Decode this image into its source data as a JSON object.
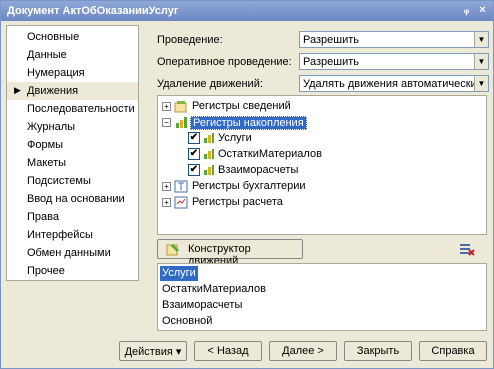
{
  "window": {
    "title": "Документ АктОбОказанииУслуг",
    "pin_glyph": "ᵩ",
    "close_glyph": "×"
  },
  "sidebar": {
    "items": [
      {
        "label": "Основные"
      },
      {
        "label": "Данные"
      },
      {
        "label": "Нумерация"
      },
      {
        "label": "Движения",
        "active": true
      },
      {
        "label": "Последовательности"
      },
      {
        "label": "Журналы"
      },
      {
        "label": "Формы"
      },
      {
        "label": "Макеты"
      },
      {
        "label": "Подсистемы"
      },
      {
        "label": "Ввод на основании"
      },
      {
        "label": "Права"
      },
      {
        "label": "Интерфейсы"
      },
      {
        "label": "Обмен данными"
      },
      {
        "label": "Прочее"
      }
    ],
    "active_arrow": "▶"
  },
  "form": {
    "posting": {
      "label": "Проведение:",
      "value": "Разрешить"
    },
    "online_posting": {
      "label": "Оперативное проведение:",
      "value": "Разрешить"
    },
    "delete_movements": {
      "label": "Удаление движений:",
      "value": "Удалять движения автоматически"
    }
  },
  "tree": {
    "expanded_glyph": "−",
    "collapsed_glyph": "+",
    "check_glyph": "✔",
    "nodes": [
      {
        "label": "Регистры сведений",
        "icon": "info-register-icon"
      },
      {
        "label": "Регистры накопления",
        "icon": "accumulation-register-icon",
        "selected": true
      },
      {
        "label": "Регистры бухгалтерии",
        "icon": "accounting-register-icon"
      },
      {
        "label": "Регистры расчета",
        "icon": "calculation-register-icon"
      }
    ],
    "children": [
      {
        "label": "Услуги"
      },
      {
        "label": "ОстаткиМатериалов"
      },
      {
        "label": "Взаиморасчеты"
      }
    ]
  },
  "constructor_button": {
    "label": "Конструктор движений"
  },
  "register_list": {
    "items": [
      {
        "label": "Услуги",
        "selected": true
      },
      {
        "label": "ОстаткиМатериалов"
      },
      {
        "label": "Взаиморасчеты"
      },
      {
        "label": "Основной"
      }
    ]
  },
  "footer": {
    "actions_label": "Действия",
    "actions_arrow": "▾",
    "back_label": "< Назад",
    "next_label": "Далее >",
    "close_label": "Закрыть",
    "help_label": "Справка"
  },
  "colors": {
    "selection": "#316ac5",
    "titlebar": "#7a96c8",
    "panel": "#ece9d8"
  }
}
